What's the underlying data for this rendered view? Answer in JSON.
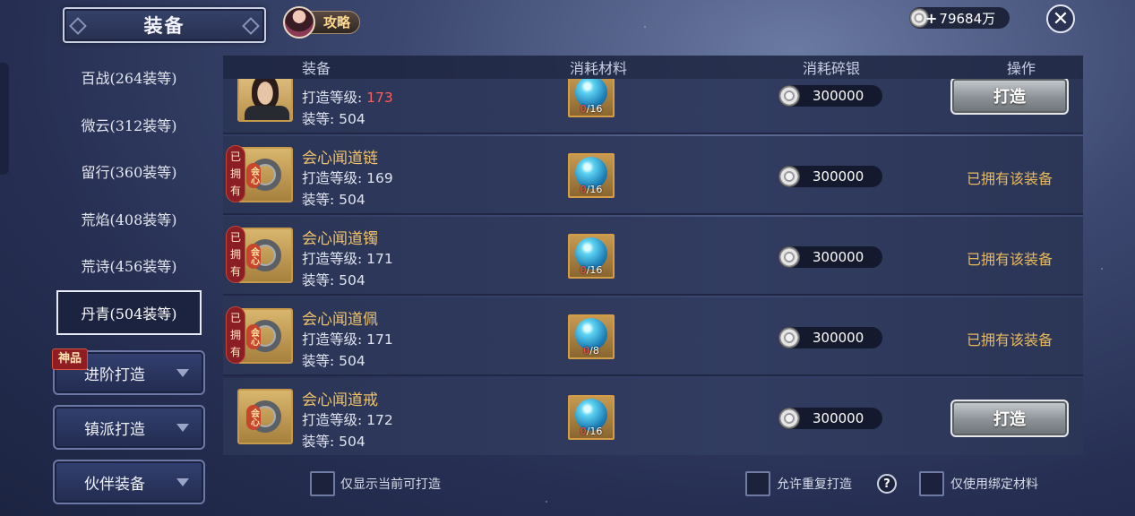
{
  "header": {
    "title": "装备",
    "guide_label": "攻略",
    "currency_plus": "+",
    "currency_amount": "79684万",
    "close_glyph": "✕"
  },
  "sidebar": {
    "tiers": [
      {
        "label": "百战(264装等)",
        "active": false
      },
      {
        "label": "微云(312装等)",
        "active": false
      },
      {
        "label": "留行(360装等)",
        "active": false
      },
      {
        "label": "荒焰(408装等)",
        "active": false
      },
      {
        "label": "荒诗(456装等)",
        "active": false
      },
      {
        "label": "丹青(504装等)",
        "active": true
      }
    ],
    "badge": "神品",
    "menus": [
      {
        "label": "进阶打造"
      },
      {
        "label": "镇派打造"
      },
      {
        "label": "伙伴装备"
      }
    ]
  },
  "table": {
    "headers": {
      "equip": "装备",
      "material": "消耗材料",
      "silver": "消耗碎银",
      "action": "操作"
    },
    "level_prefix": "打造等级: ",
    "score_prefix": "装等: ",
    "owned_tag_chars": [
      "已",
      "拥",
      "有"
    ],
    "item_tag": "会心",
    "rows": [
      {
        "name": "",
        "level": "173",
        "level_low": true,
        "score": "504",
        "mat_have": "0",
        "mat_need": "/16",
        "cost": "300000",
        "owned": false,
        "action": "打造",
        "portrait": true
      },
      {
        "name": "会心闻道链",
        "level": "169",
        "level_low": false,
        "score": "504",
        "mat_have": "0",
        "mat_need": "/16",
        "cost": "300000",
        "owned": true,
        "action": "已拥有该装备",
        "portrait": false
      },
      {
        "name": "会心闻道镯",
        "level": "171",
        "level_low": false,
        "score": "504",
        "mat_have": "0",
        "mat_need": "/16",
        "cost": "300000",
        "owned": true,
        "action": "已拥有该装备",
        "portrait": false
      },
      {
        "name": "会心闻道佩",
        "level": "171",
        "level_low": false,
        "score": "504",
        "mat_have": "0",
        "mat_need": "/8",
        "cost": "300000",
        "owned": true,
        "action": "已拥有该装备",
        "portrait": false
      },
      {
        "name": "会心闻道戒",
        "level": "172",
        "level_low": false,
        "score": "504",
        "mat_have": "0",
        "mat_need": "/16",
        "cost": "300000",
        "owned": false,
        "action": "打造",
        "portrait": false
      }
    ]
  },
  "footer": {
    "only_craftable": "仅显示当前可打造",
    "allow_repeat": "允许重复打造",
    "help_glyph": "?",
    "bound_only": "仅使用绑定材料"
  },
  "colors": {
    "accent_gold": "#f0c36a",
    "low_level_red": "#ff5c5c",
    "owned_text": "#e9b95a"
  }
}
